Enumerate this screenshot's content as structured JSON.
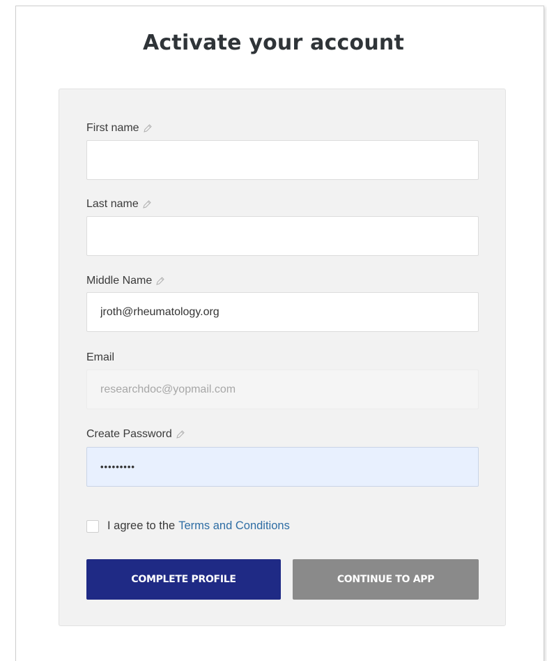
{
  "page": {
    "title": "Activate your account"
  },
  "form": {
    "first_name": {
      "label": "First name",
      "value": "",
      "icon": "pencil-icon"
    },
    "last_name": {
      "label": "Last name",
      "value": "",
      "icon": "pencil-icon"
    },
    "middle_name": {
      "label": "Middle Name",
      "value": "jroth@rheumatology.org",
      "icon": "pencil-icon"
    },
    "email": {
      "label": "Email",
      "value": "researchdoc@yopmail.com",
      "disabled": true
    },
    "password": {
      "label": "Create Password",
      "value": "•••••••••",
      "icon": "pencil-icon"
    },
    "terms": {
      "prefix": "I agree to the",
      "link_text": "Terms and Conditions",
      "checked": false
    }
  },
  "buttons": {
    "complete_profile": "COMPLETE PROFILE",
    "continue_to_app": "CONTINUE TO APP"
  },
  "colors": {
    "primary_button": "#1f2a85",
    "secondary_button": "#8a8a8a",
    "link": "#2e6da4",
    "autofill_background": "#e8f0fe"
  }
}
